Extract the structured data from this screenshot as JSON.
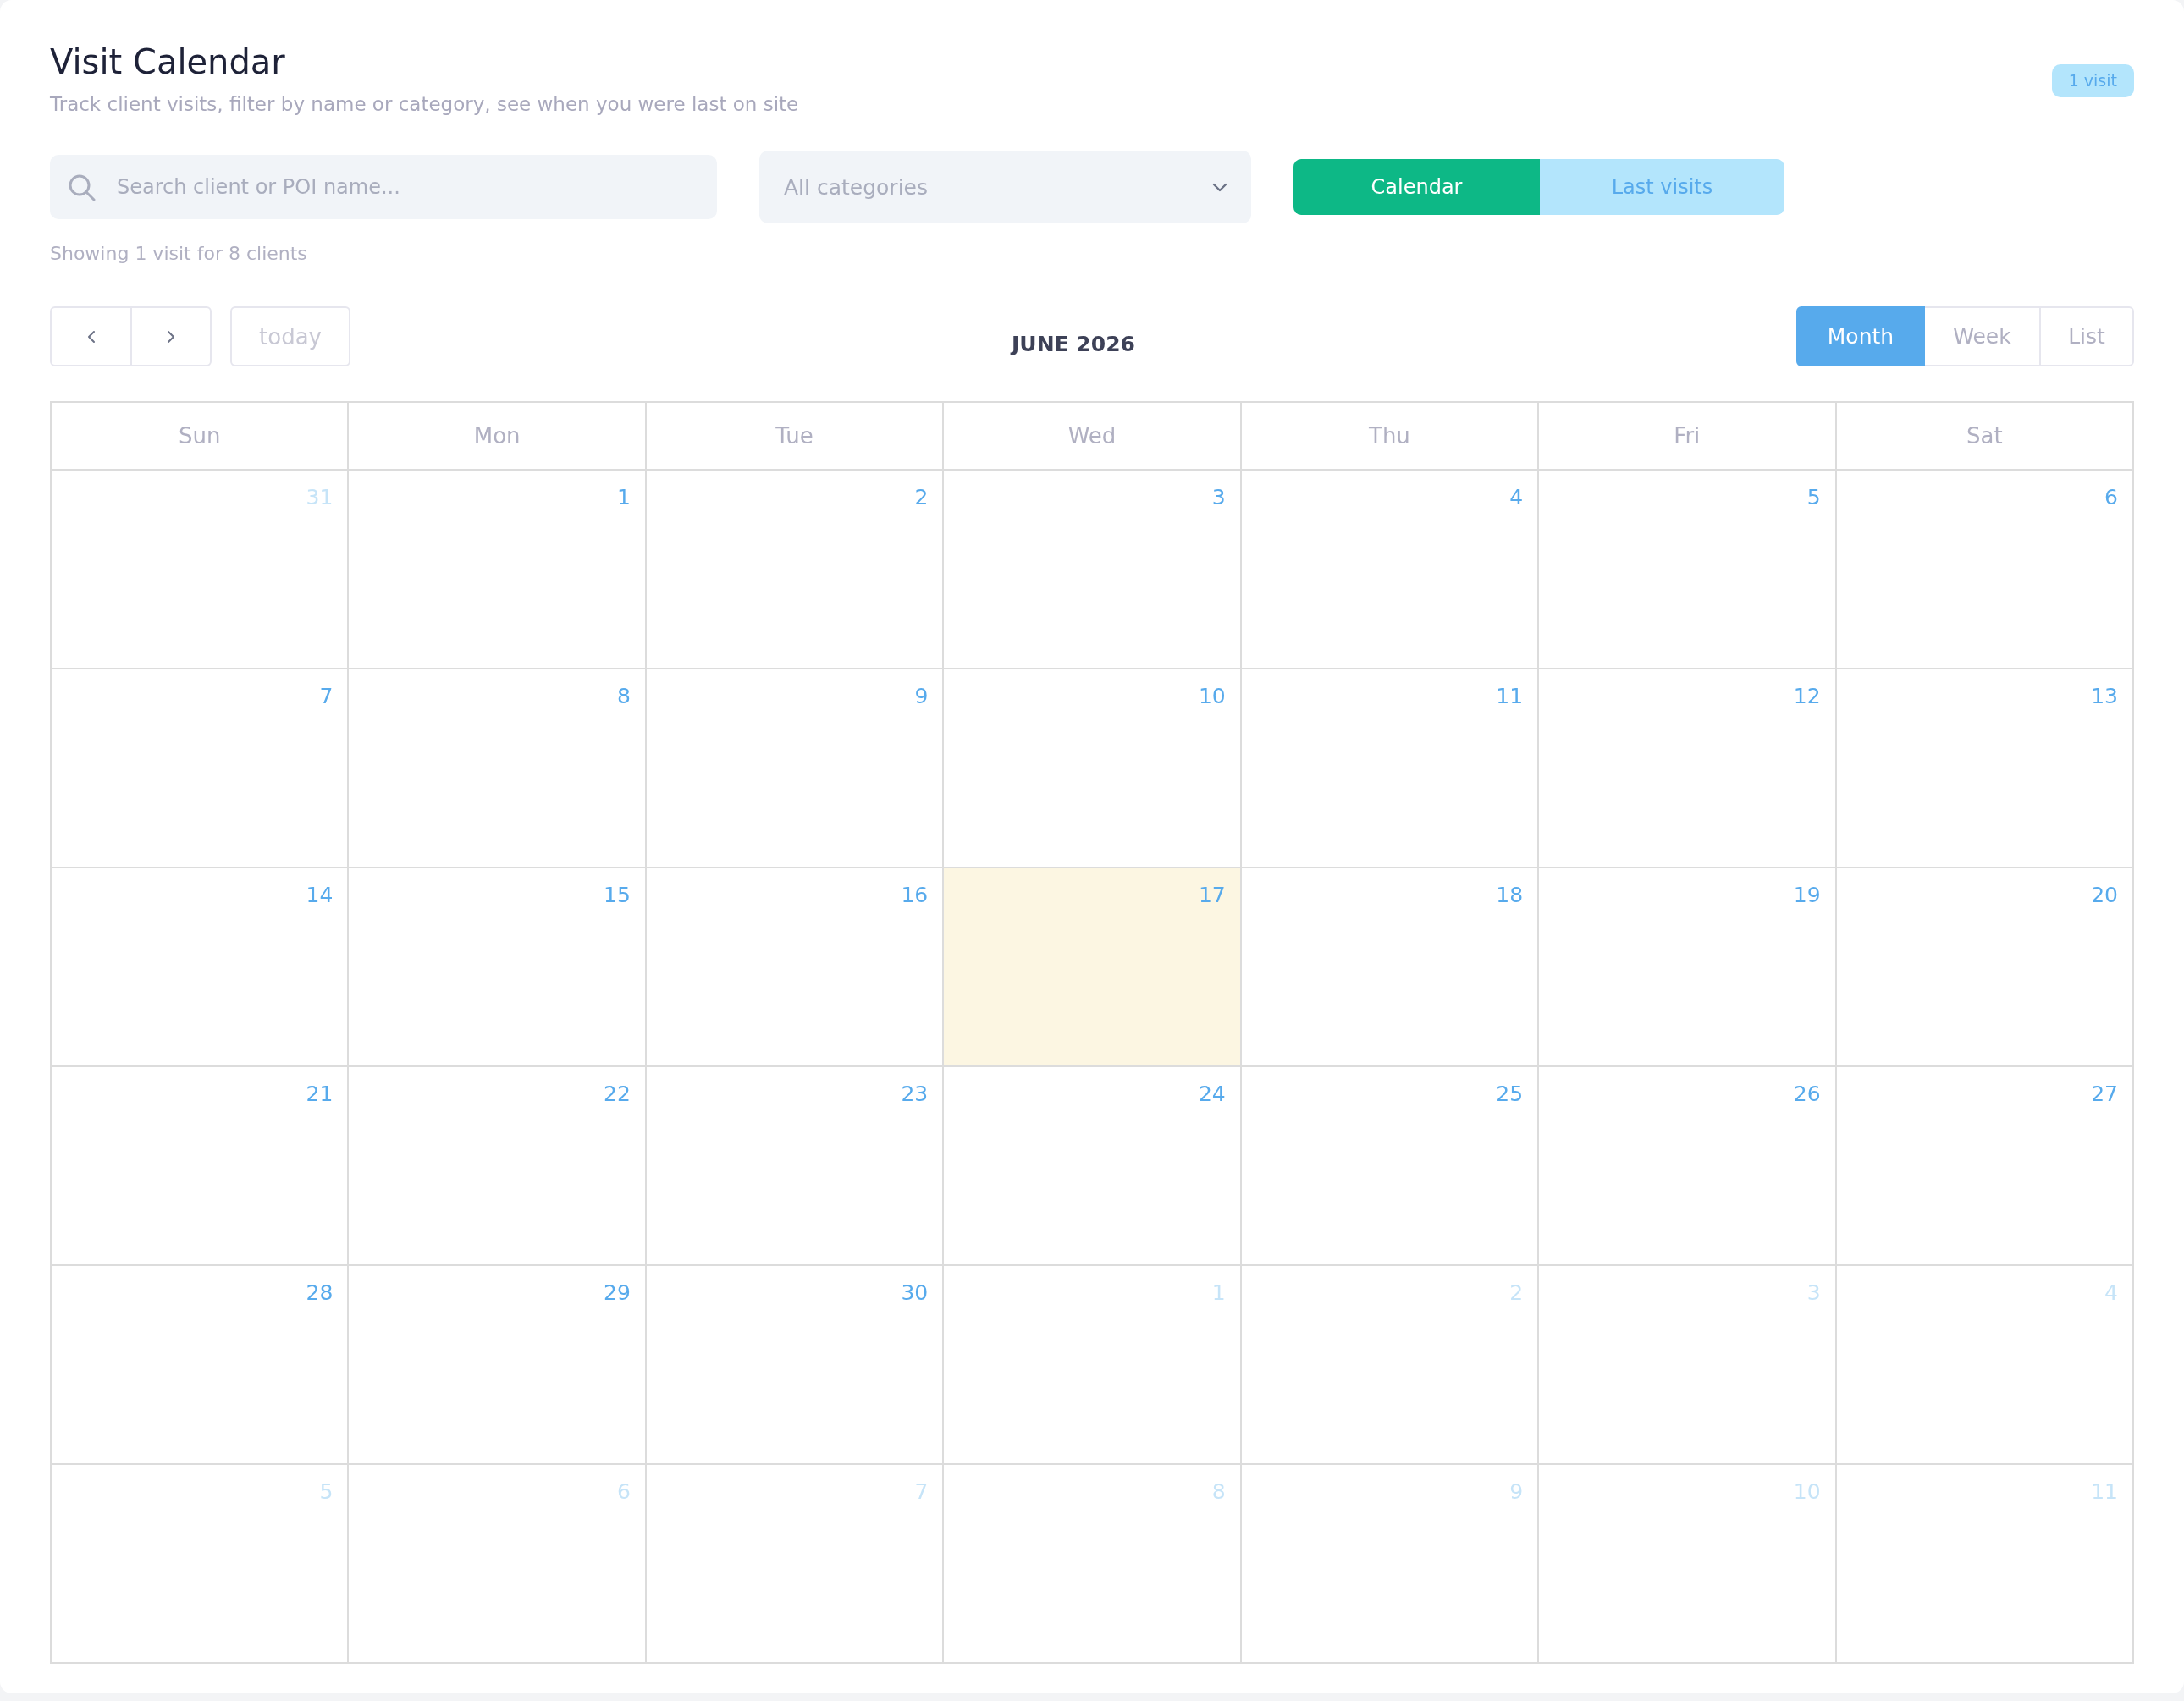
{
  "header": {
    "title": "Visit Calendar",
    "subtitle": "Track client visits, filter by name or category, see when you were last on site",
    "badge": "1 visit"
  },
  "filters": {
    "search": {
      "placeholder": "Search client or POI name..."
    },
    "category": {
      "value": "All categories"
    },
    "modes": [
      {
        "label": "Calendar",
        "selected": true
      },
      {
        "label": "Last visits",
        "selected": false
      }
    ]
  },
  "summary": "Showing 1 visit for 8 clients",
  "toolbar": {
    "today": {
      "label": "today",
      "disabled": true
    },
    "title": "JUNE 2026",
    "views": [
      {
        "label": "Month",
        "selected": true
      },
      {
        "label": "Week",
        "selected": false
      },
      {
        "label": "List",
        "selected": false
      }
    ]
  },
  "calendar": {
    "weekdays": [
      "Sun",
      "Mon",
      "Tue",
      "Wed",
      "Thu",
      "Fri",
      "Sat"
    ],
    "weeks": [
      [
        {
          "day": "31",
          "other_month": true,
          "today": false
        },
        {
          "day": "1",
          "other_month": false,
          "today": false
        },
        {
          "day": "2",
          "other_month": false,
          "today": false
        },
        {
          "day": "3",
          "other_month": false,
          "today": false
        },
        {
          "day": "4",
          "other_month": false,
          "today": false
        },
        {
          "day": "5",
          "other_month": false,
          "today": false
        },
        {
          "day": "6",
          "other_month": false,
          "today": false
        }
      ],
      [
        {
          "day": "7",
          "other_month": false,
          "today": false
        },
        {
          "day": "8",
          "other_month": false,
          "today": false
        },
        {
          "day": "9",
          "other_month": false,
          "today": false
        },
        {
          "day": "10",
          "other_month": false,
          "today": false
        },
        {
          "day": "11",
          "other_month": false,
          "today": false
        },
        {
          "day": "12",
          "other_month": false,
          "today": false
        },
        {
          "day": "13",
          "other_month": false,
          "today": false
        }
      ],
      [
        {
          "day": "14",
          "other_month": false,
          "today": false
        },
        {
          "day": "15",
          "other_month": false,
          "today": false
        },
        {
          "day": "16",
          "other_month": false,
          "today": false
        },
        {
          "day": "17",
          "other_month": false,
          "today": true
        },
        {
          "day": "18",
          "other_month": false,
          "today": false
        },
        {
          "day": "19",
          "other_month": false,
          "today": false
        },
        {
          "day": "20",
          "other_month": false,
          "today": false
        }
      ],
      [
        {
          "day": "21",
          "other_month": false,
          "today": false
        },
        {
          "day": "22",
          "other_month": false,
          "today": false
        },
        {
          "day": "23",
          "other_month": false,
          "today": false
        },
        {
          "day": "24",
          "other_month": false,
          "today": false
        },
        {
          "day": "25",
          "other_month": false,
          "today": false
        },
        {
          "day": "26",
          "other_month": false,
          "today": false
        },
        {
          "day": "27",
          "other_month": false,
          "today": false
        }
      ],
      [
        {
          "day": "28",
          "other_month": false,
          "today": false
        },
        {
          "day": "29",
          "other_month": false,
          "today": false
        },
        {
          "day": "30",
          "other_month": false,
          "today": false
        },
        {
          "day": "1",
          "other_month": true,
          "today": false
        },
        {
          "day": "2",
          "other_month": true,
          "today": false
        },
        {
          "day": "3",
          "other_month": true,
          "today": false
        },
        {
          "day": "4",
          "other_month": true,
          "today": false
        }
      ],
      [
        {
          "day": "5",
          "other_month": true,
          "today": false
        },
        {
          "day": "6",
          "other_month": true,
          "today": false
        },
        {
          "day": "7",
          "other_month": true,
          "today": false
        },
        {
          "day": "8",
          "other_month": true,
          "today": false
        },
        {
          "day": "9",
          "other_month": true,
          "today": false
        },
        {
          "day": "10",
          "other_month": true,
          "today": false
        },
        {
          "day": "11",
          "other_month": true,
          "today": false
        }
      ]
    ]
  }
}
